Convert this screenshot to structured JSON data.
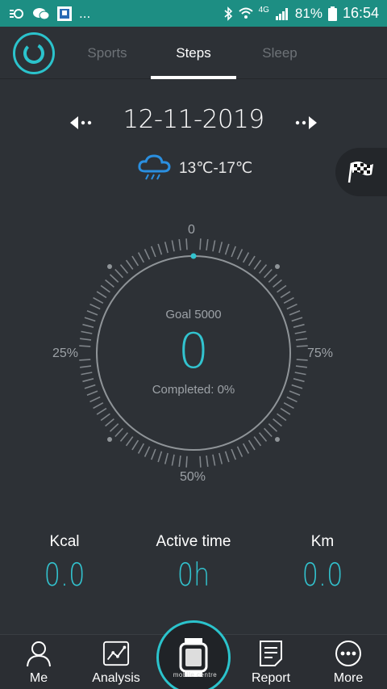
{
  "status_bar": {
    "notification_icons": [
      "bluetooth-sync-icon",
      "wechat-icon",
      "app-icon"
    ],
    "more_dots": "...",
    "network_type": "4G",
    "battery_percent": "81%",
    "time": "16:54"
  },
  "header": {
    "tabs": [
      {
        "label": "Sports",
        "active": false
      },
      {
        "label": "Steps",
        "active": true
      },
      {
        "label": "Sleep",
        "active": false
      }
    ]
  },
  "date": {
    "text": "12-11-2019"
  },
  "weather": {
    "icon": "rain-cloud-icon",
    "temperature": "13℃-17℃"
  },
  "dial": {
    "top_label": "0",
    "left_label": "25%",
    "right_label": "75%",
    "bottom_label": "50%",
    "goal_text": "Goal 5000",
    "steps_value": "0",
    "completed_text": "Completed: 0%",
    "progress_fraction": 0
  },
  "stats": [
    {
      "label": "Kcal",
      "value": "0.0"
    },
    {
      "label": "Active time",
      "value": "0h"
    },
    {
      "label": "Km",
      "value": "0.0"
    }
  ],
  "bottom_nav": {
    "items": [
      {
        "label": "Me",
        "icon": "person-icon"
      },
      {
        "label": "Analysis",
        "icon": "chart-icon"
      },
      {
        "label": "Report",
        "icon": "document-icon"
      },
      {
        "label": "More",
        "icon": "more-dots-icon"
      }
    ],
    "center_icon": "watch-icon",
    "watermark": "mobile centre"
  },
  "colors": {
    "accent": "#32c3cf",
    "status_bar": "#1d8e83",
    "background": "#2d3136"
  }
}
